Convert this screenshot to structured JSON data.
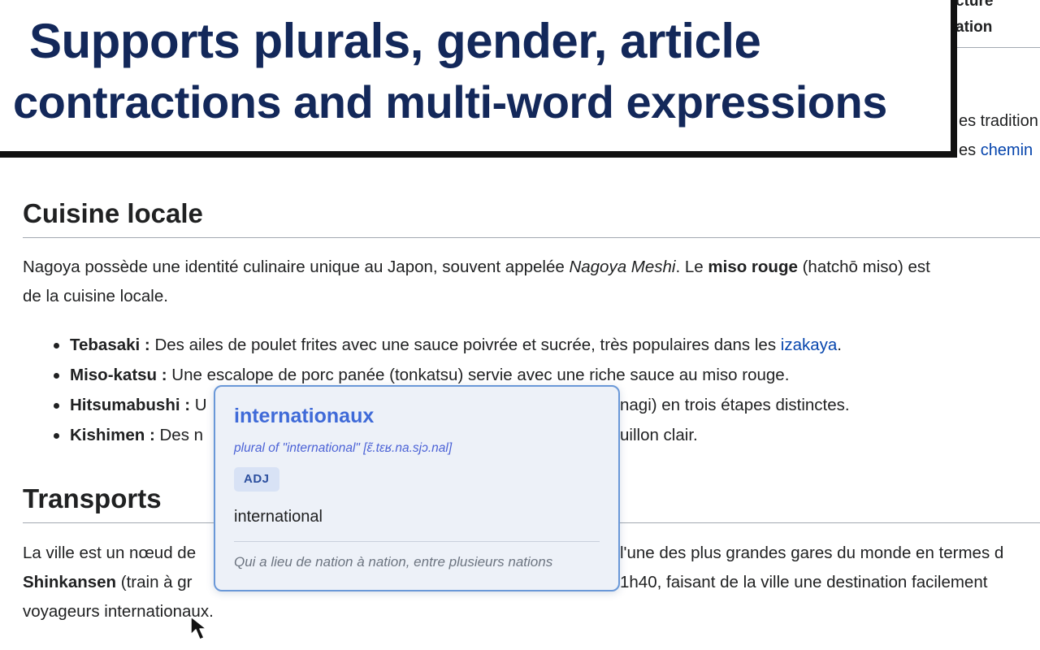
{
  "banner": {
    "line1": "Supports plurals, gender, article",
    "line2": "contractions and multi-word expressions"
  },
  "background_fragments": {
    "nav1": "cture",
    "nav2": "ation",
    "para_line1": "es tradition",
    "para_line2_text": "es ",
    "para_line2_link": "chemin"
  },
  "sections": {
    "cuisine": {
      "heading": "Cuisine locale",
      "para": {
        "l1_a": "Nagoya possède une identité culinaire unique au Japon, souvent appelée ",
        "l1_i": "Nagoya Meshi",
        "l1_b": ". Le ",
        "l1_bold": "miso rouge",
        "l1_c": " (hatchō miso) est",
        "l2": "de la cuisine locale."
      },
      "items": [
        {
          "term": "Tebasaki :",
          "text": " Des ailes de poulet frites avec une sauce poivrée et sucrée, très populaires dans les ",
          "link": "izakaya",
          "end": "."
        },
        {
          "term": "Miso-katsu :",
          "text": " Une escalope de porc panée (tonkatsu) servie avec une riche sauce au miso rouge."
        },
        {
          "term": "Hitsumabushi :",
          "text": " U",
          "tail": "nagi) en trois étapes distinctes."
        },
        {
          "term": "Kishimen :",
          "text": " Des n",
          "tail": "uillon clair."
        }
      ]
    },
    "transports": {
      "heading": "Transports",
      "l1_a": "La ville est un nœud de",
      "l1_b": "l'une des plus grandes gares du monde en termes d",
      "l2_bold": "Shinkansen",
      "l2_a": " (train à gr",
      "l2_b": " 1h40, faisant de la ville une destination facilement",
      "l3": "voyageurs internationaux."
    }
  },
  "popup": {
    "word": "internationaux",
    "subtitle": "plural of \"international\" [ɛ̃.tɛʁ.na.sjɔ.nal]",
    "pos": "ADJ",
    "lemma": "international",
    "definition": "Qui a lieu de nation à nation, entre plusieurs nations"
  },
  "colors": {
    "banner_text": "#13285a",
    "link": "#3366cc",
    "popup_bg": "#edf1f8",
    "popup_border": "#6a98d8",
    "popup_word": "#3f6ad8"
  },
  "icons": {
    "cursor": "mouse-pointer-icon"
  }
}
